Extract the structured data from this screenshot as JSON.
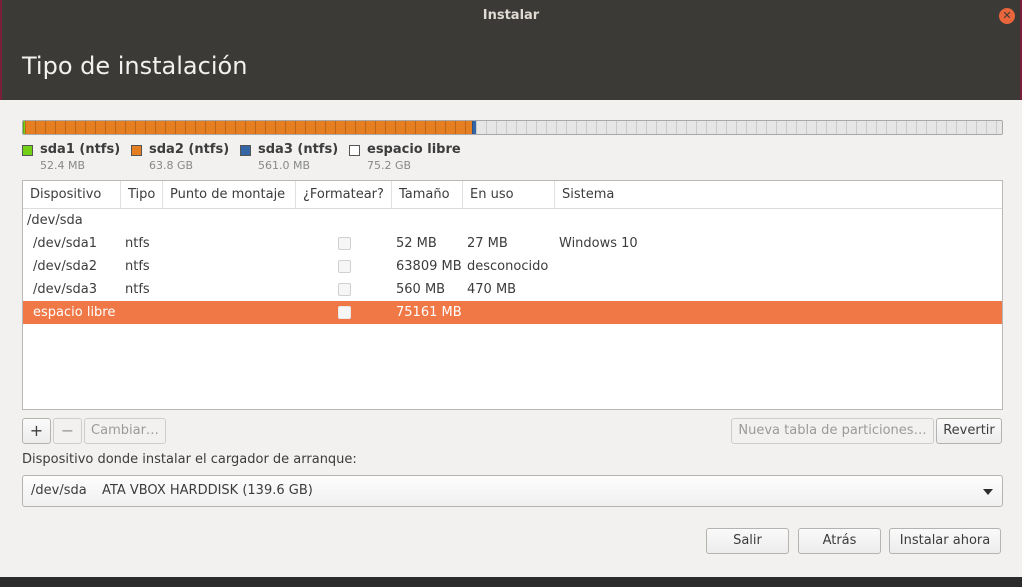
{
  "window": {
    "title": "Instalar",
    "close_icon": "close-icon",
    "page_title": "Tipo de instalación"
  },
  "partition_bar": {
    "segments": [
      {
        "name": "sda1 (ntfs)",
        "fraction": 0.0004,
        "color": "#73d216"
      },
      {
        "name": "sda2 (ntfs)",
        "fraction": 0.457,
        "color": "#e67e22"
      },
      {
        "name": "sda3 (ntfs)",
        "fraction": 0.004,
        "color": "#3465a4"
      },
      {
        "name": "espacio libre",
        "fraction": 0.5386,
        "color": "#e6e6e6"
      }
    ]
  },
  "legend": [
    {
      "name": "sda1 (ntfs)",
      "size": "52.4 MB",
      "color": "#73d216"
    },
    {
      "name": "sda2 (ntfs)",
      "size": "63.8 GB",
      "color": "#e67e22"
    },
    {
      "name": "sda3 (ntfs)",
      "size": "561.0 MB",
      "color": "#3465a4"
    },
    {
      "name": "espacio libre",
      "size": "75.2 GB",
      "color": "#ffffff"
    }
  ],
  "table": {
    "columns": [
      "Dispositivo",
      "Tipo",
      "Punto de montaje",
      "¿Formatear?",
      "Tamaño",
      "En uso",
      "Sistema"
    ],
    "rows": [
      {
        "device": "/dev/sda",
        "type": "",
        "mount": "",
        "format": null,
        "size": "",
        "used": "",
        "system": ""
      },
      {
        "device": "/dev/sda1",
        "type": "ntfs",
        "mount": "",
        "format": false,
        "size": "52 MB",
        "used": "27 MB",
        "system": "Windows 10"
      },
      {
        "device": "/dev/sda2",
        "type": "ntfs",
        "mount": "",
        "format": false,
        "size": "63809 MB",
        "used": "desconocido",
        "system": ""
      },
      {
        "device": "/dev/sda3",
        "type": "ntfs",
        "mount": "",
        "format": false,
        "size": "560 MB",
        "used": "470 MB",
        "system": ""
      },
      {
        "device": "espacio libre",
        "type": "",
        "mount": "",
        "format": false,
        "size": "75161 MB",
        "used": "",
        "system": "",
        "selected": true
      }
    ]
  },
  "toolbar": {
    "add_label": "+",
    "remove_label": "−",
    "change_label": "Cambiar…",
    "new_table_label": "Nueva tabla de particiones…",
    "revert_label": "Revertir"
  },
  "bootloader": {
    "label": "Dispositivo donde instalar el cargador de arranque:",
    "device": "/dev/sda",
    "description": "ATA VBOX HARDDISK (139.6 GB)"
  },
  "footer": {
    "quit_label": "Salir",
    "back_label": "Atrás",
    "install_label": "Instalar ahora"
  },
  "colors": {
    "accent": "#f07746",
    "titlebar": "#3b3a37",
    "background": "#f2f1f0"
  }
}
